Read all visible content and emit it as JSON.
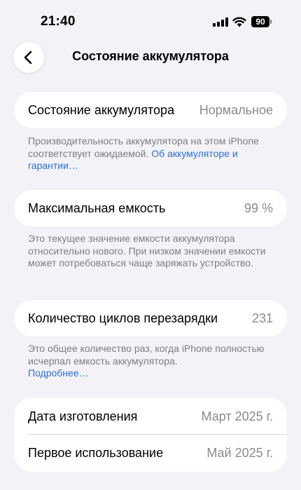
{
  "status_bar": {
    "time": "21:40",
    "battery_level": "90"
  },
  "header": {
    "title": "Состояние аккумулятора"
  },
  "health": {
    "label": "Состояние аккумулятора",
    "value": "Нормальное",
    "footnote": "Производительность аккумулятора на этом iPhone соответствует ожидаемой.",
    "link": "Об аккумуля­торе и гарантии…"
  },
  "capacity": {
    "label": "Максимальная емкость",
    "value": "99 %",
    "footnote": "Это текущее значение емкости аккумулятора относительно нового. При низком значении емкости может потребоваться чаще заряжать устройство."
  },
  "cycles": {
    "label": "Количество циклов перезарядки",
    "value": "231",
    "footnote": "Это общее количество раз, когда iPhone полностью исчерпал емкость аккумулятора.",
    "link": "Подробнее…"
  },
  "dates": {
    "manufacture_label": "Дата изготовления",
    "manufacture_value": "Март 2025 г.",
    "first_use_label": "Первое использование",
    "first_use_value": "Май 2025 г."
  },
  "icons": {
    "back": "chevron-left-icon",
    "signal": "cellular-signal-icon",
    "wifi": "wifi-icon",
    "battery": "battery-icon"
  }
}
